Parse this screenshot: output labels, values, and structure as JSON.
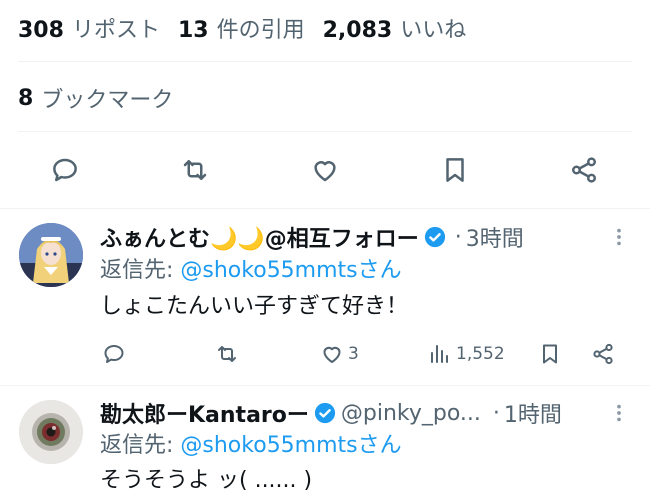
{
  "stats": {
    "reposts_count": "308",
    "reposts_label": "リポスト",
    "quotes_count": "13",
    "quotes_label": "件の引用",
    "likes_count": "2,083",
    "likes_label": "いいね"
  },
  "bookmarks": {
    "count": "8",
    "label": "ブックマーク"
  },
  "replies": [
    {
      "display_name": "ふぁんとむ🌙🌙@相互フォロー",
      "verified": true,
      "dot": "·",
      "time": "3時間",
      "reply_prefix": "返信先: ",
      "reply_handle": "@shoko55mmtsさん",
      "text": "しょこたんいい子すぎて好き！",
      "reply_count": "",
      "retweet_count": "",
      "like_count": "3",
      "view_count": "1,552"
    },
    {
      "display_name": "勘太郎ーKantaroー",
      "verified": true,
      "handle": "@pinky_po...",
      "dot": "·",
      "time": "1時間",
      "reply_prefix": "返信先: ",
      "reply_handle": "@shoko55mmtsさん",
      "text": "そうそうよ ッ( ...... )"
    }
  ],
  "colors": {
    "accent": "#1d9bf0",
    "secondary_text": "#536471",
    "primary_text": "#0f1419",
    "divider": "#eff3f4"
  },
  "icons": {
    "reply": "reply-icon",
    "repost": "repost-icon",
    "like": "heart-icon",
    "bookmark": "bookmark-icon",
    "share": "share-icon",
    "views": "views-icon",
    "more": "more-icon",
    "verified": "verified-badge-icon"
  }
}
